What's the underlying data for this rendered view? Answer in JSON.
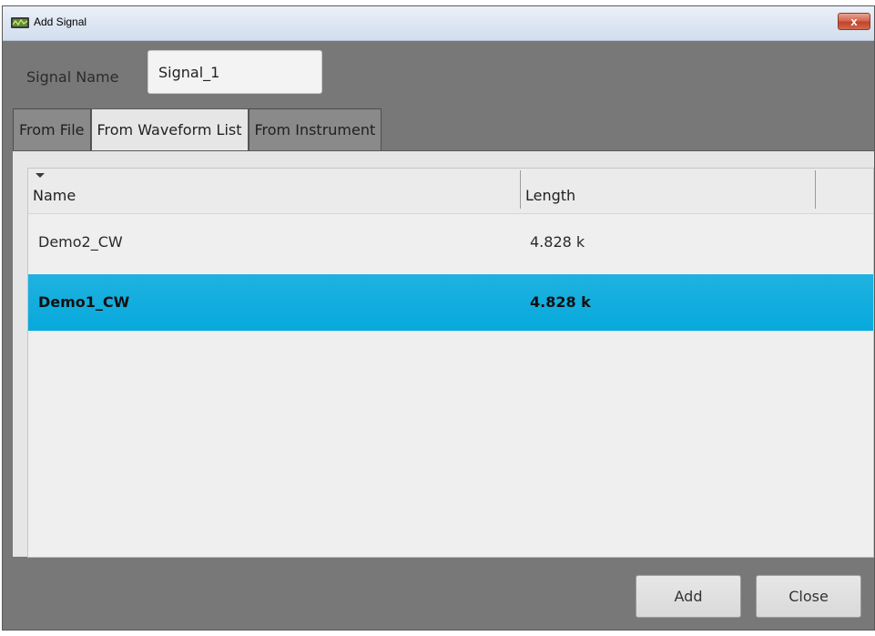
{
  "window": {
    "title": "Add Signal",
    "close_symbol": "x"
  },
  "signal_name": {
    "label": "Signal Name",
    "value": "Signal_1"
  },
  "tabs": [
    {
      "label": "From File",
      "active": false
    },
    {
      "label": "From Waveform List",
      "active": true
    },
    {
      "label": "From Instrument",
      "active": false
    }
  ],
  "grid": {
    "columns": [
      "Name",
      "Length"
    ],
    "sort_column": "Name",
    "sort_direction": "descending",
    "rows": [
      {
        "name": "Demo2_CW",
        "length": "4.828 k",
        "selected": false
      },
      {
        "name": "Demo1_CW",
        "length": "4.828 k",
        "selected": true
      }
    ]
  },
  "buttons": {
    "add": "Add",
    "close": "Close"
  },
  "colors": {
    "selection": "#07a9dc",
    "window_background": "#787878",
    "panel_background": "#e6e6e6"
  },
  "icons": {
    "app": "app-icon",
    "window_close": "close-icon",
    "sort": "sort-descending-icon"
  }
}
